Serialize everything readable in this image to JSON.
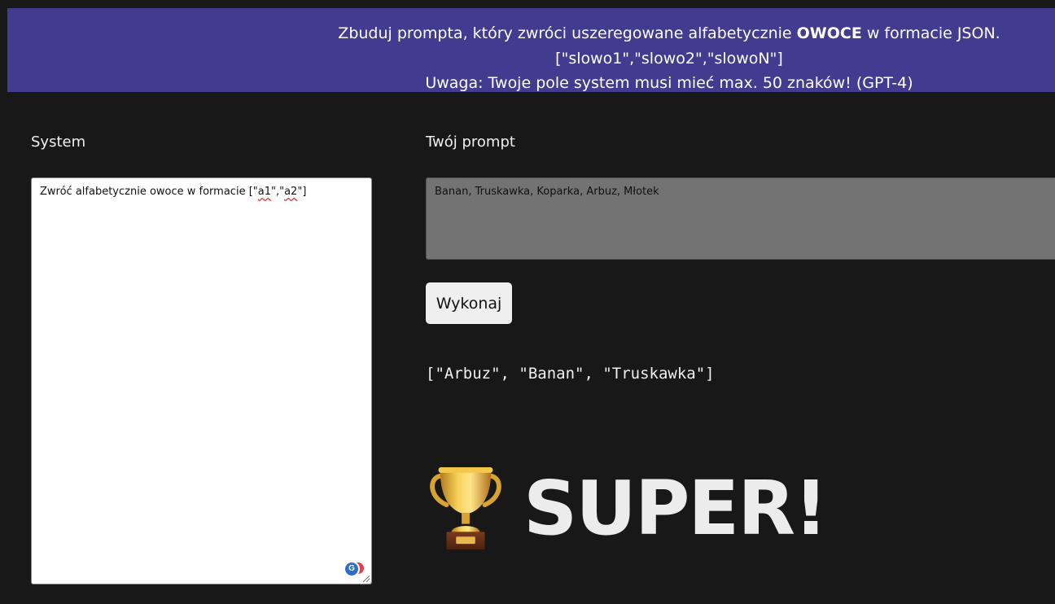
{
  "banner": {
    "line1_before": "Zbuduj prompta, który zwróci uszeregowane alfabetycznie ",
    "line1_bold": "OWOCE",
    "line1_after": " w formacie JSON.",
    "line2": "[\"slowo1\",\"slowo2\",\"slowoN\"]",
    "line3": "Uwaga: Twoje pole system musi mieć max. 50 znaków! (GPT-4)"
  },
  "system": {
    "label": "System",
    "text_before": "Zwróć alfabetycznie owoce w formacie [\"",
    "text_a1": "a1",
    "text_mid": "\",\"",
    "text_a2": "a2",
    "text_after": "\"]",
    "badge_icon": "grammarly-icon",
    "badge_letter": "G"
  },
  "prompt": {
    "label": "Twój prompt",
    "value": "Banan, Truskawka, Koparka, Arbuz, Młotek"
  },
  "run_button": {
    "label": "Wykonaj"
  },
  "result": {
    "text": "[\"Arbuz\", \"Banan\", \"Truskawka\"]"
  },
  "success": {
    "icon": "trophy-icon",
    "text": "SUPER!"
  },
  "colors": {
    "background": "#181818",
    "banner": "#423c90",
    "prompt_field": "#737373",
    "button": "#efefef"
  }
}
